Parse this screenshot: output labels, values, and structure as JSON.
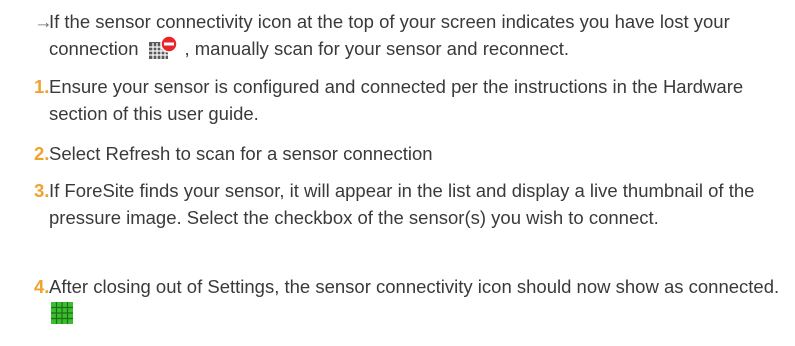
{
  "steps": [
    {
      "marker": "→",
      "text_before": "If the sensor connectivity icon at the top of your screen indicates you have lost your connection",
      "text_after": ", manually scan for your sensor and reconnect.",
      "icon": "sensor-disconnected-icon"
    },
    {
      "marker": "1.",
      "text": "Ensure your sensor is configured and connected per the instructions in the Hardware section of this user guide."
    },
    {
      "marker": "2.",
      "text": "Select Refresh to scan for a sensor connection"
    },
    {
      "marker": "3.",
      "text": "If ForeSite finds your sensor, it will appear in the list and display a live thumbnail of the pressure image. Select the checkbox of the sensor(s) you wish to connect."
    },
    {
      "marker": "4.",
      "text": "After closing out of Settings, the sensor connectivity icon should now show as connected.",
      "icon": "sensor-connected-icon"
    }
  ],
  "colors": {
    "number": "#f0a22e",
    "arrow": "#6e6e6e",
    "text": "#3a3a3a",
    "connected": "#3bbd2f",
    "disconnected": "#e8232a"
  }
}
